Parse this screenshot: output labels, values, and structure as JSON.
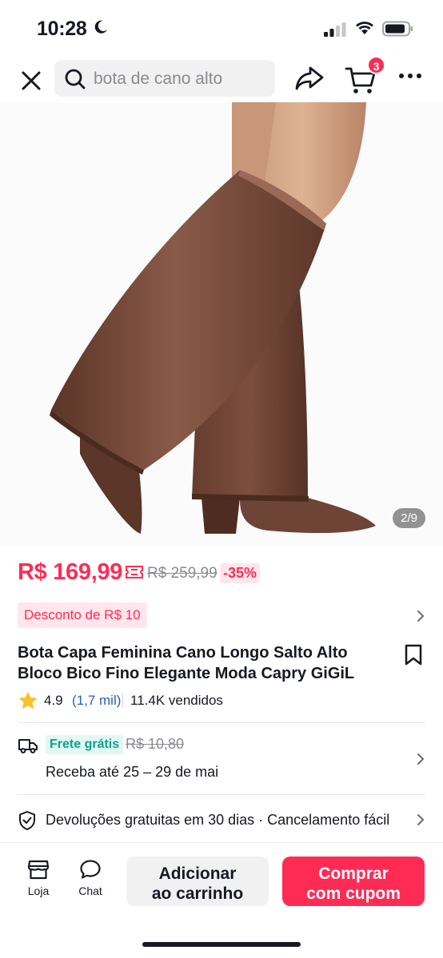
{
  "status_bar": {
    "time": "10:28"
  },
  "header": {
    "search_placeholder": "bota de cano alto",
    "cart_count": "3"
  },
  "gallery": {
    "counter": "2/9"
  },
  "price": {
    "current": "R$ 169,99",
    "original": "R$ 259,99",
    "discount": "-35%"
  },
  "promo": {
    "label": "Desconto de R$ 10"
  },
  "product": {
    "title": "Bota Capa Feminina Cano Longo Salto Alto Bloco Bico Fino Elegante Moda Capry GiGiL",
    "rating": "4.9",
    "reviews": "(1,7 mil)",
    "sold": "11.4K vendidos"
  },
  "shipping": {
    "free_label": "Frete grátis",
    "old_price": "R$ 10,80",
    "eta": "Receba até 25 – 29 de mai"
  },
  "returns": {
    "text": "Devoluções gratuitas em 30 dias · Cancelamento fácil"
  },
  "bottom_bar": {
    "store_label": "Loja",
    "chat_label": "Chat",
    "add_to_cart": [
      "Adicionar",
      "ao carrinho"
    ],
    "buy": [
      "Comprar",
      "com cupom"
    ]
  },
  "colors": {
    "accent": "#fe2c55",
    "free_shipping": "#0ea38a",
    "review_link": "#2b5db5",
    "boot": "#6e4436"
  },
  "icons": [
    "moon-icon",
    "signal-icon",
    "wifi-icon",
    "battery-icon",
    "close-icon",
    "search-icon",
    "share-icon",
    "cart-icon",
    "more-icon",
    "coupon-icon",
    "chevron-right-icon",
    "bookmark-icon",
    "star-icon",
    "truck-icon",
    "shield-icon",
    "store-icon",
    "chat-icon"
  ]
}
